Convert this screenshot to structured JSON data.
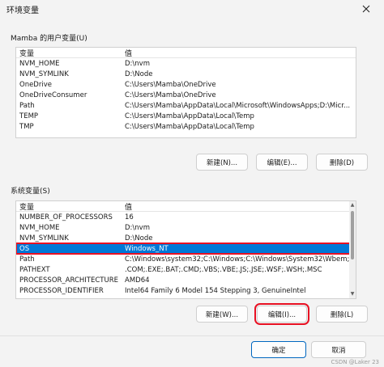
{
  "window": {
    "title": "环境变量"
  },
  "user_section": {
    "label": "Mamba 的用户变量(U)",
    "headers": {
      "variable": "变量",
      "value": "值"
    },
    "rows": [
      {
        "variable": "NVM_HOME",
        "value": "D:\\nvm"
      },
      {
        "variable": "NVM_SYMLINK",
        "value": "D:\\Node"
      },
      {
        "variable": "OneDrive",
        "value": "C:\\Users\\Mamba\\OneDrive"
      },
      {
        "variable": "OneDriveConsumer",
        "value": "C:\\Users\\Mamba\\OneDrive"
      },
      {
        "variable": "Path",
        "value": "C:\\Users\\Mamba\\AppData\\Local\\Microsoft\\WindowsApps;D:\\Micr..."
      },
      {
        "variable": "TEMP",
        "value": "C:\\Users\\Mamba\\AppData\\Local\\Temp"
      },
      {
        "variable": "TMP",
        "value": "C:\\Users\\Mamba\\AppData\\Local\\Temp"
      }
    ],
    "buttons": {
      "new": "新建(N)...",
      "edit": "编辑(E)...",
      "delete": "删除(D)"
    }
  },
  "system_section": {
    "label": "系统变量(S)",
    "headers": {
      "variable": "变量",
      "value": "值"
    },
    "rows": [
      {
        "variable": "NUMBER_OF_PROCESSORS",
        "value": "16"
      },
      {
        "variable": "NVM_HOME",
        "value": "D:\\nvm"
      },
      {
        "variable": "NVM_SYMLINK",
        "value": "D:\\Node"
      },
      {
        "variable": "OS",
        "value": "Windows_NT"
      },
      {
        "variable": "Path",
        "value": "C:\\Windows\\system32;C:\\Windows;C:\\Windows\\System32\\Wbem;..."
      },
      {
        "variable": "PATHEXT",
        "value": ".COM;.EXE;.BAT;.CMD;.VBS;.VBE;.JS;.JSE;.WSF;.WSH;.MSC"
      },
      {
        "variable": "PROCESSOR_ARCHITECTURE",
        "value": "AMD64"
      },
      {
        "variable": "PROCESSOR_IDENTIFIER",
        "value": "Intel64 Family 6 Model 154 Stepping 3, GenuineIntel"
      }
    ],
    "buttons": {
      "new": "新建(W)...",
      "edit": "编辑(I)...",
      "delete": "删除(L)"
    }
  },
  "dialog_buttons": {
    "ok": "确定",
    "cancel": "取消"
  },
  "watermark": "CSDN @Laker 23",
  "colors": {
    "selection": "#0078d7",
    "annotation_red": "#e81123"
  }
}
